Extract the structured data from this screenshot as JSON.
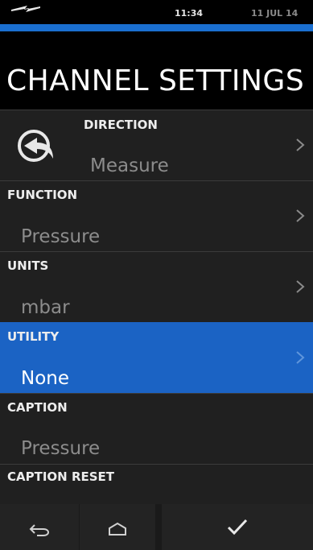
{
  "status": {
    "time": "11:34",
    "date": "11 JUL 14",
    "signal_icon": "lightning-signal-icon"
  },
  "page": {
    "title": "CHANNEL SETTINGS"
  },
  "settings": [
    {
      "label": "DIRECTION",
      "value": "Measure",
      "icon": "direction-arrow-icon",
      "selected": false
    },
    {
      "label": "FUNCTION",
      "value": "Pressure",
      "selected": false
    },
    {
      "label": "UNITS",
      "value": "mbar",
      "selected": false
    },
    {
      "label": "UTILITY",
      "value": "None",
      "selected": true
    },
    {
      "label": "CAPTION",
      "value": "Pressure",
      "selected": false
    },
    {
      "label": "CAPTION RESET",
      "value": "",
      "selected": false
    }
  ],
  "nav": {
    "back": "back-icon",
    "home": "home-icon",
    "confirm": "checkmark-icon"
  },
  "colors": {
    "accent": "#1b63c4",
    "background": "#000000",
    "row": "#202020"
  }
}
